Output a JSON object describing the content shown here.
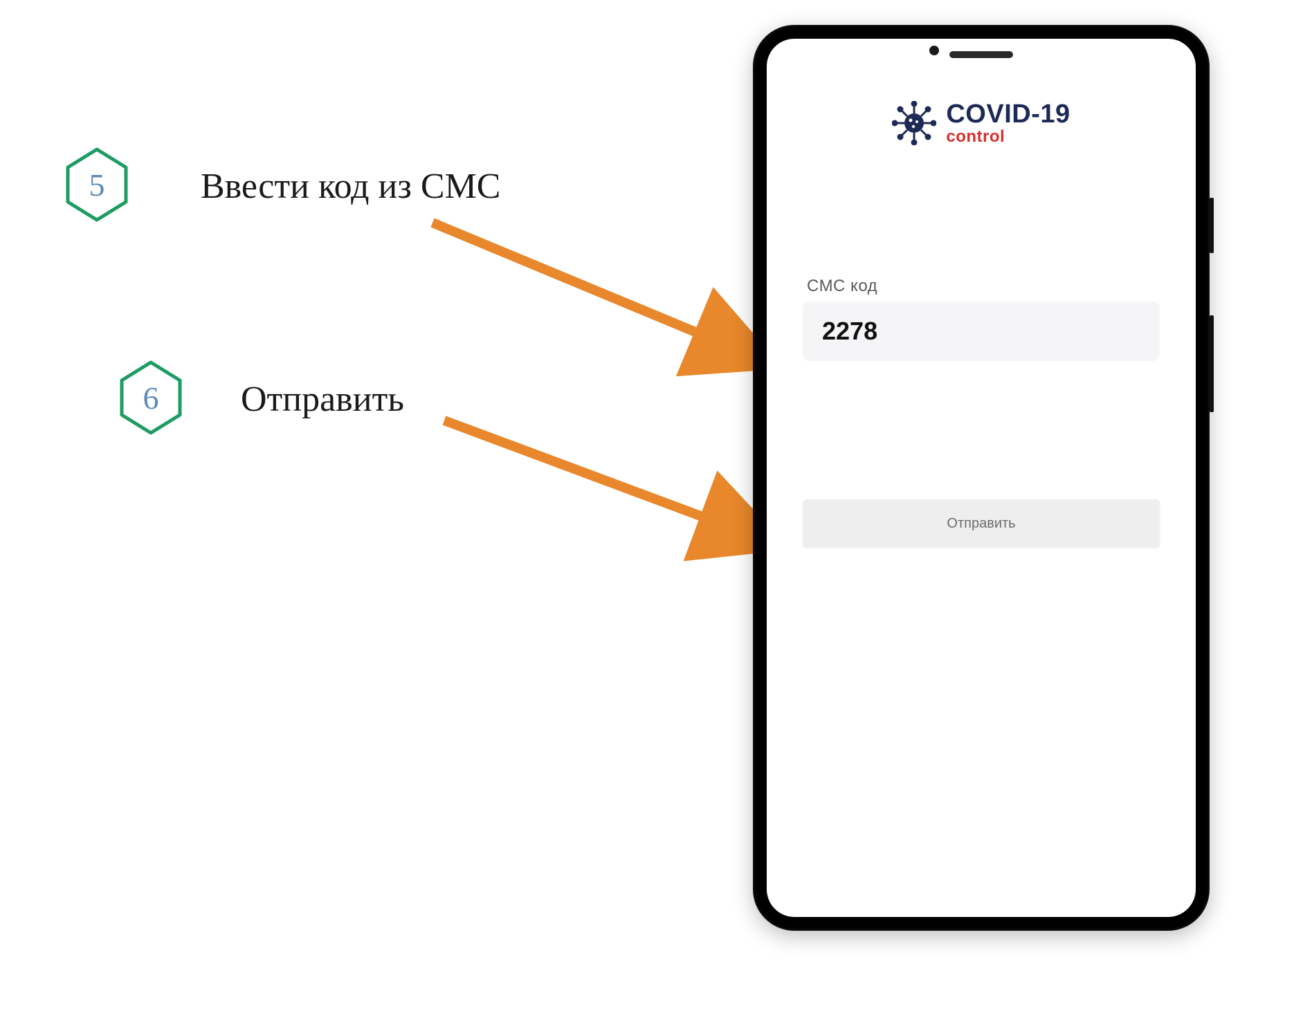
{
  "steps": [
    {
      "number": "5",
      "label": "Ввести код из СМС"
    },
    {
      "number": "6",
      "label": "Отправить"
    }
  ],
  "app": {
    "logo_line1": "COVID-19",
    "logo_line2": "control",
    "sms_label": "СМС  код",
    "sms_value": "2278",
    "submit_label": "Отправить"
  },
  "colors": {
    "hex_outline": "#1e9c63",
    "step_number": "#5a8ab7",
    "arrow": "#e8872b",
    "logo_primary": "#1d2a56",
    "logo_accent": "#d62f2f"
  }
}
